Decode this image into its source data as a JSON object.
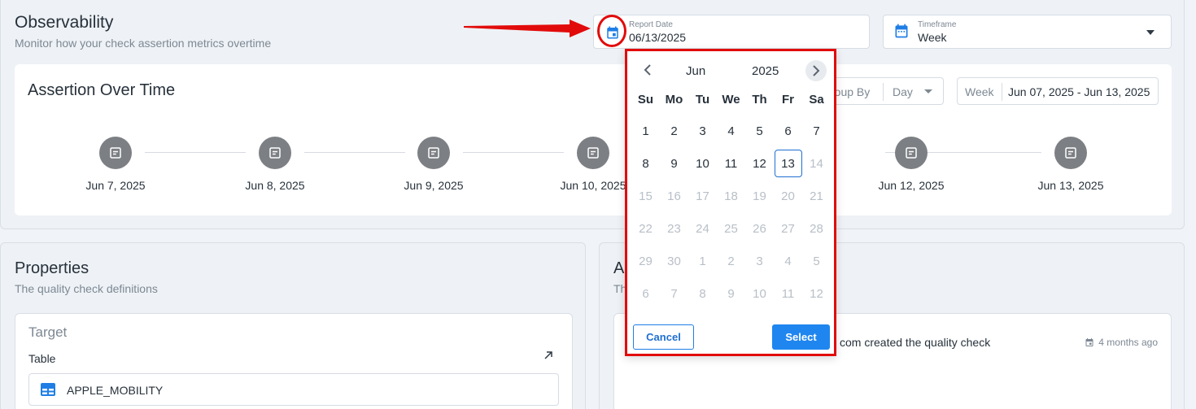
{
  "header": {
    "title": "Observability",
    "subtitle": "Monitor how your check assertion metrics overtime"
  },
  "report_date": {
    "label": "Report Date",
    "value": "06/13/2025",
    "icon": "calendar-icon"
  },
  "timeframe": {
    "label": "Timeframe",
    "value": "Week",
    "icon": "calendar-icon"
  },
  "assertion": {
    "title": "Assertion Over Time",
    "group_by_label": "Group By",
    "group_by_label_visible": "roup By",
    "group_by_value": "Day",
    "week_label": "Week",
    "week_range": "Jun 07, 2025 - Jun 13, 2025",
    "timeline": [
      {
        "label": "Jun 7, 2025"
      },
      {
        "label": "Jun 8, 2025"
      },
      {
        "label": "Jun 9, 2025"
      },
      {
        "label": "Jun 10, 2025"
      },
      {
        "label": "Jun 12, 2025"
      },
      {
        "label": "Jun 13, 2025"
      }
    ]
  },
  "properties": {
    "title": "Properties",
    "subtitle": "The quality check definitions",
    "target_heading": "Target",
    "table_label": "Table",
    "table_value": "APPLE_MOBILITY"
  },
  "activity": {
    "title_visible": "A",
    "subtitle_visible": "Th",
    "entry_text": "com created the quality check",
    "entry_time": "4 months ago"
  },
  "datepicker": {
    "month": "Jun",
    "year": "2025",
    "weekdays": [
      "Su",
      "Mo",
      "Tu",
      "We",
      "Th",
      "Fr",
      "Sa"
    ],
    "days": [
      {
        "d": "1",
        "dis": false
      },
      {
        "d": "2",
        "dis": false
      },
      {
        "d": "3",
        "dis": false
      },
      {
        "d": "4",
        "dis": false
      },
      {
        "d": "5",
        "dis": false
      },
      {
        "d": "6",
        "dis": false
      },
      {
        "d": "7",
        "dis": false
      },
      {
        "d": "8",
        "dis": false
      },
      {
        "d": "9",
        "dis": false
      },
      {
        "d": "10",
        "dis": false
      },
      {
        "d": "11",
        "dis": false
      },
      {
        "d": "12",
        "dis": false
      },
      {
        "d": "13",
        "dis": false,
        "sel": true
      },
      {
        "d": "14",
        "dis": true
      },
      {
        "d": "15",
        "dis": true
      },
      {
        "d": "16",
        "dis": true
      },
      {
        "d": "17",
        "dis": true
      },
      {
        "d": "18",
        "dis": true
      },
      {
        "d": "19",
        "dis": true
      },
      {
        "d": "20",
        "dis": true
      },
      {
        "d": "21",
        "dis": true
      },
      {
        "d": "22",
        "dis": true
      },
      {
        "d": "23",
        "dis": true
      },
      {
        "d": "24",
        "dis": true
      },
      {
        "d": "25",
        "dis": true
      },
      {
        "d": "26",
        "dis": true
      },
      {
        "d": "27",
        "dis": true
      },
      {
        "d": "28",
        "dis": true
      },
      {
        "d": "29",
        "dis": true
      },
      {
        "d": "30",
        "dis": true
      },
      {
        "d": "1",
        "dis": true
      },
      {
        "d": "2",
        "dis": true
      },
      {
        "d": "3",
        "dis": true
      },
      {
        "d": "4",
        "dis": true
      },
      {
        "d": "5",
        "dis": true
      },
      {
        "d": "6",
        "dis": true
      },
      {
        "d": "7",
        "dis": true
      },
      {
        "d": "8",
        "dis": true
      },
      {
        "d": "9",
        "dis": true
      },
      {
        "d": "10",
        "dis": true
      },
      {
        "d": "11",
        "dis": true
      },
      {
        "d": "12",
        "dis": true
      }
    ],
    "cancel_label": "Cancel",
    "select_label": "Select"
  },
  "colors": {
    "accent": "#1f86f0",
    "annotation_red": "#e20b0b",
    "node_gray": "#7c7f83"
  }
}
